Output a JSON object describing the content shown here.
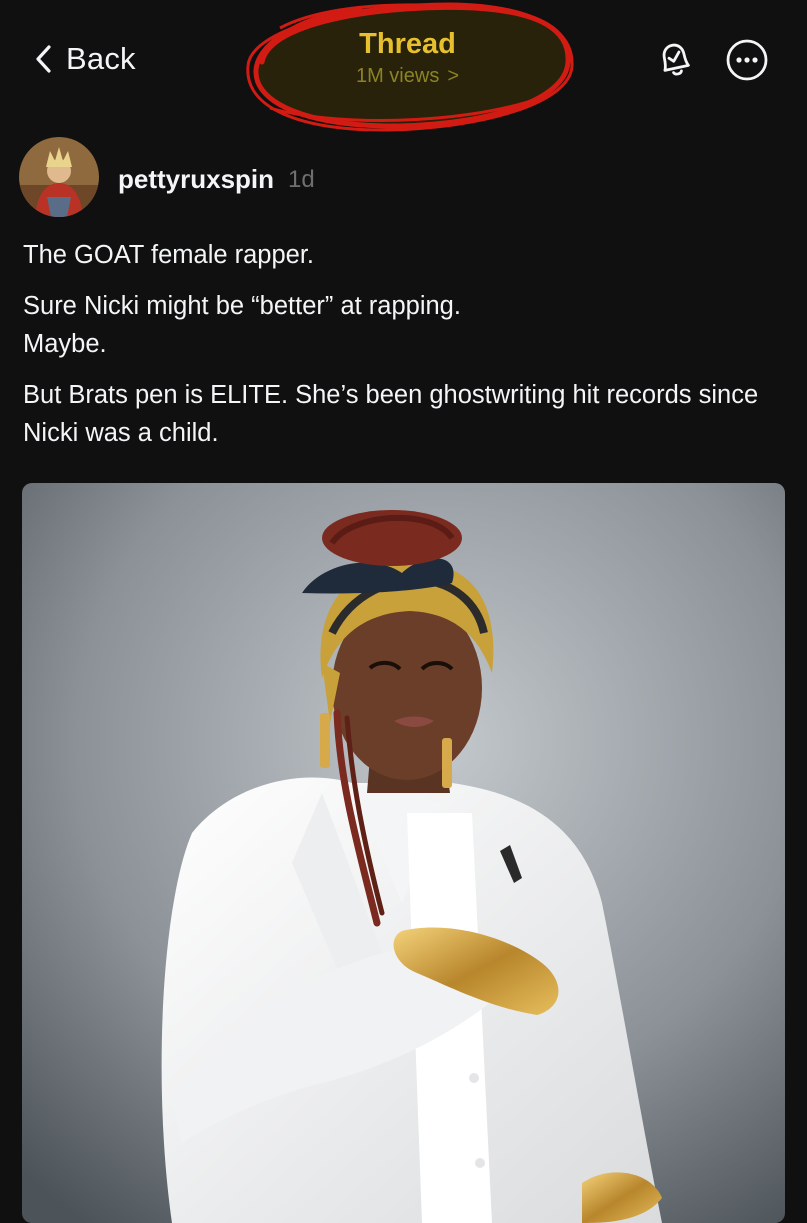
{
  "header": {
    "back_label": "Back",
    "title": "Thread",
    "views": "1M views",
    "views_chevron": ">",
    "highlight_color": "#d11b13",
    "title_color": "#e6c02e"
  },
  "actions": {
    "notify_icon": "bell-check-icon",
    "more_icon": "more-horizontal-icon"
  },
  "post": {
    "username": "pettyruxspin",
    "timestamp": "1d",
    "paragraphs": [
      "The GOAT female rapper.",
      "Sure Nicki might be “better” at rapping.",
      "Maybe.",
      "But Brats pen is ELITE. She’s been ghostwriting hit records since Nicki was a child."
    ]
  },
  "colors": {
    "background": "#101010",
    "text_primary": "#f3f5f7",
    "text_secondary": "#6f6f6f"
  }
}
